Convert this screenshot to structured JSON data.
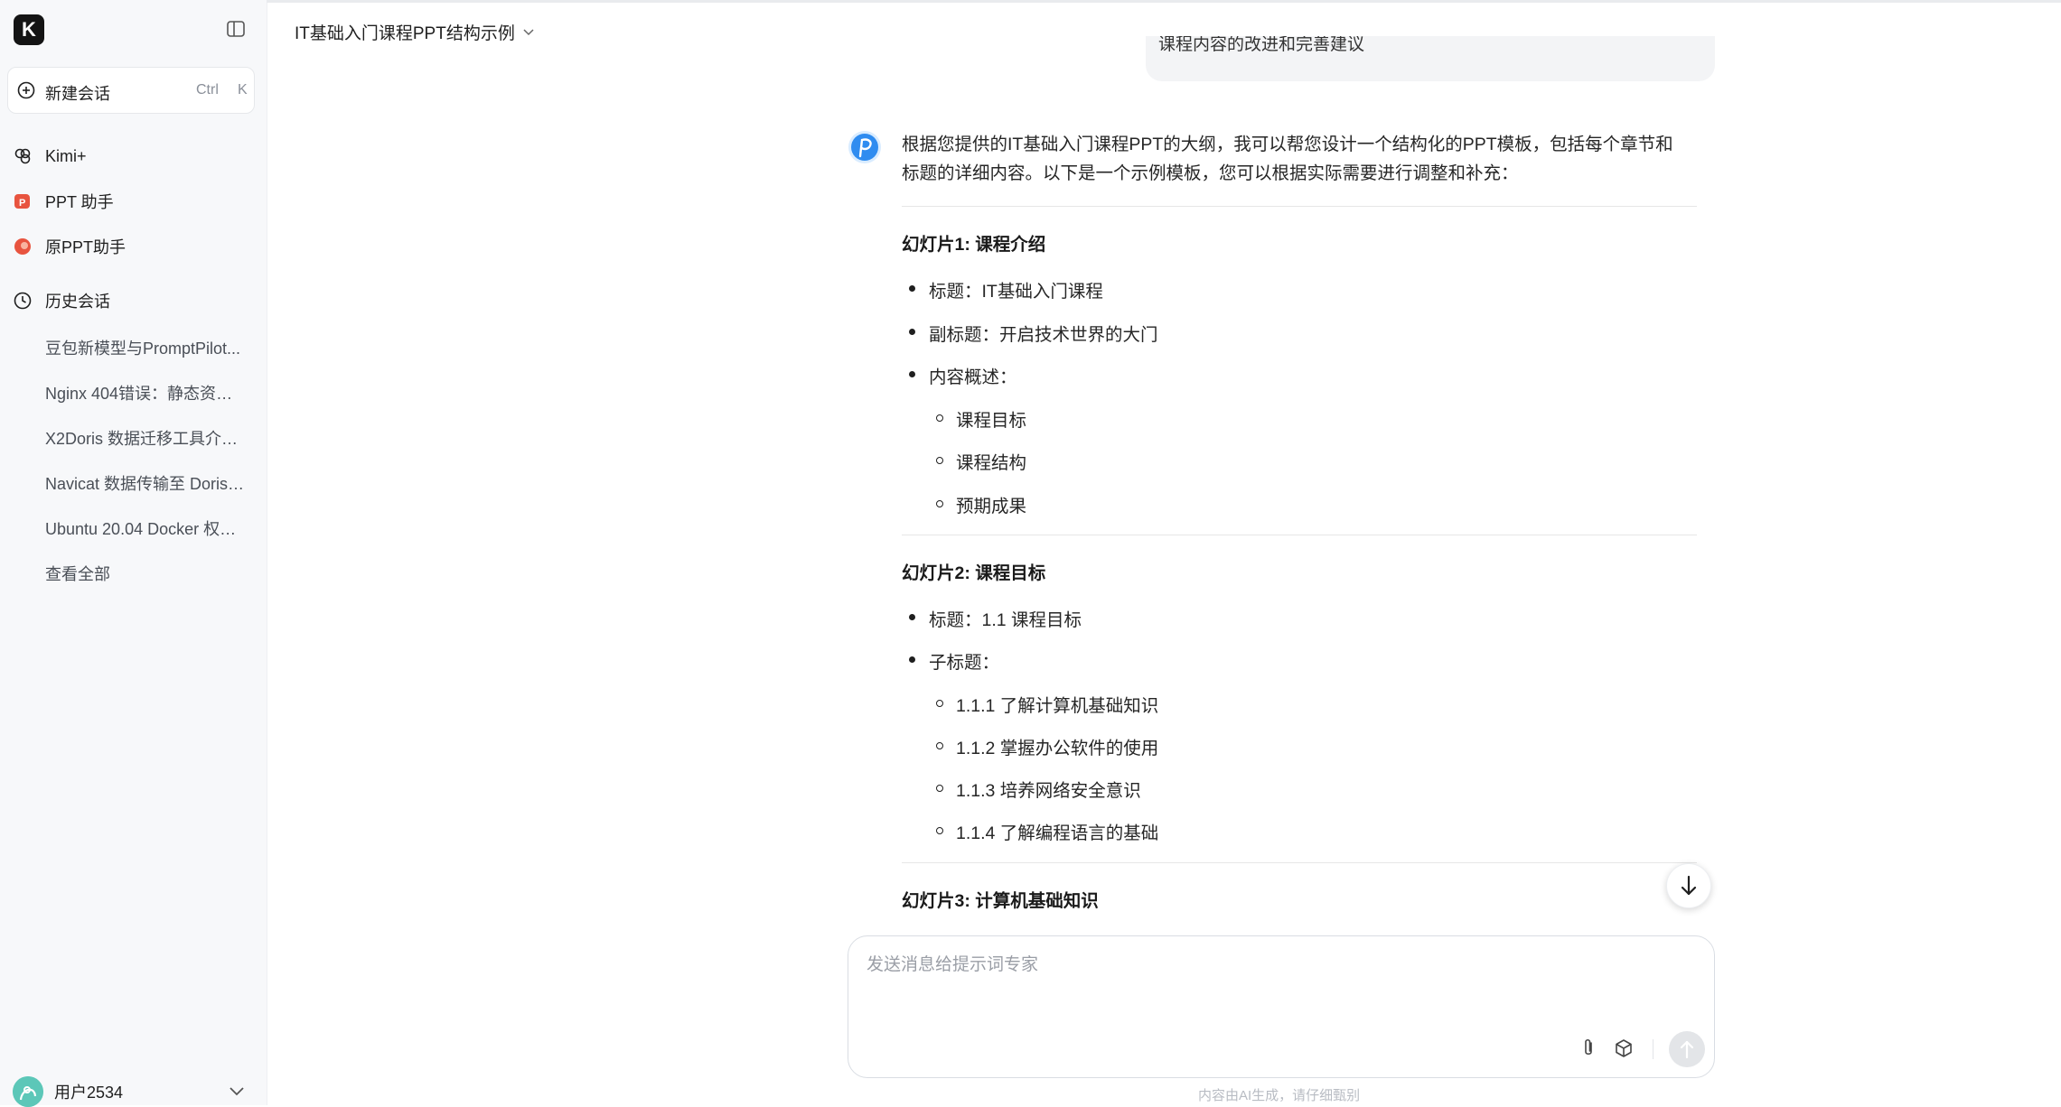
{
  "sidebar": {
    "logo_letter": "K",
    "new_chat": {
      "label": "新建会话",
      "shortcut_ctrl": "Ctrl",
      "shortcut_key": "K"
    },
    "nav": [
      {
        "label": "Kimi+",
        "icon": "kimi-plus-icon"
      },
      {
        "label": "PPT 助手",
        "icon": "ppt-icon"
      },
      {
        "label": "原PPT助手",
        "icon": "ppt-original-icon"
      }
    ],
    "history": {
      "title": "历史会话",
      "items": [
        "豆包新模型与PromptPilot...",
        "Nginx 404错误：静态资源...",
        "X2Doris 数据迁移工具介绍...",
        "Navicat 数据传输至 Doris ...",
        "Ubuntu 20.04 Docker 权限..."
      ],
      "view_all": "查看全部"
    },
    "user": {
      "name": "用户2534"
    }
  },
  "header": {
    "title": "IT基础入门课程PPT结构示例"
  },
  "conversation": {
    "prev_user_message": "课程内容的改进和完善建议",
    "assistant": {
      "intro_line1": "根据您提供的IT基础入门课程PPT的大纲，我可以帮您设计一个结构化的PPT模板，包括每个章节和",
      "intro_line2": "标题的详细内容。以下是一个示例模板，您可以根据实际需要进行调整和补充：",
      "slides": [
        {
          "title": "幻灯片1: 课程介绍",
          "bullets": [
            "标题：IT基础入门课程",
            "副标题：开启技术世界的大门",
            "内容概述："
          ],
          "sub_bullets": [
            "课程目标",
            "课程结构",
            "预期成果"
          ]
        },
        {
          "title": "幻灯片2: 课程目标",
          "bullets": [
            "标题：1.1 课程目标",
            "子标题："
          ],
          "sub_bullets": [
            "1.1.1 了解计算机基础知识",
            "1.1.2 掌握办公软件的使用",
            "1.1.3 培养网络安全意识",
            "1.1.4 了解编程语言的基础"
          ]
        },
        {
          "title": "幻灯片3: 计算机基础知识"
        }
      ]
    }
  },
  "composer": {
    "placeholder": "发送消息给提示词专家"
  },
  "footer": {
    "disclaimer": "内容由AI生成，请仔细甄别"
  },
  "colors": {
    "accent": "#2f8cf0",
    "sidebar_bg": "#f7f8fa",
    "ppt_red": "#e8543f"
  }
}
